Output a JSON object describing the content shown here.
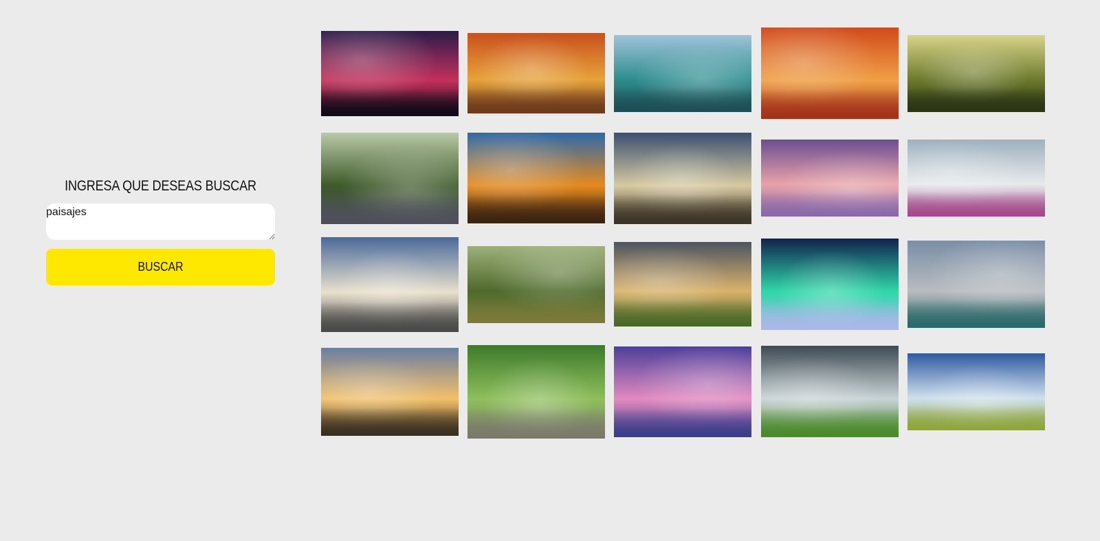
{
  "search": {
    "title": "INGRESA QUE DESEAS BUSCAR",
    "query": "paisajes",
    "button_label": "BUSCAR"
  },
  "results": [
    {
      "scene": "red-sunset-tree",
      "colors": [
        "#2a1b4a",
        "#c4305c",
        "#100a18"
      ]
    },
    {
      "scene": "autumn-forest-path",
      "colors": [
        "#c9501e",
        "#e7a23a",
        "#6d3a1a"
      ]
    },
    {
      "scene": "mountain-lake-boat",
      "colors": [
        "#9fc3d8",
        "#2e8d8f",
        "#1d4f55"
      ]
    },
    {
      "scene": "red-autumn-park",
      "colors": [
        "#d14a1c",
        "#f0a046",
        "#a3321a"
      ]
    },
    {
      "scene": "sunlit-trees-lake",
      "colors": [
        "#d9d48a",
        "#6d7a2e",
        "#2b3414"
      ]
    },
    {
      "scene": "misty-forest-road",
      "colors": [
        "#b9c9a8",
        "#3e5a2a",
        "#4f4f5c"
      ]
    },
    {
      "scene": "dramatic-sunset-clouds",
      "colors": [
        "#2d6aa8",
        "#e58a1e",
        "#3b2410"
      ]
    },
    {
      "scene": "sunrise-over-hills",
      "colors": [
        "#3b5070",
        "#d6c9a0",
        "#3c3426"
      ]
    },
    {
      "scene": "purple-lake-tree",
      "colors": [
        "#6b4e8f",
        "#e8a2a8",
        "#8a6aa8"
      ]
    },
    {
      "scene": "snowy-mountains-heather",
      "colors": [
        "#9eb0bf",
        "#e7eaec",
        "#a44a8a"
      ]
    },
    {
      "scene": "road-to-horizon",
      "colors": [
        "#4a6a9a",
        "#e9e0cc",
        "#4a4a4a"
      ]
    },
    {
      "scene": "green-forest-light",
      "colors": [
        "#9db07a",
        "#4f6a2c",
        "#7a7a3a"
      ]
    },
    {
      "scene": "giant-book-landscape",
      "colors": [
        "#4c5560",
        "#d9b26a",
        "#4a6a28"
      ]
    },
    {
      "scene": "aurora-snow",
      "colors": [
        "#0f2350",
        "#2ed8a8",
        "#a9b8e8"
      ]
    },
    {
      "scene": "alpine-lake-cabin",
      "colors": [
        "#7a8ea6",
        "#b8bcc0",
        "#2a6a6a"
      ]
    },
    {
      "scene": "river-sunset",
      "colors": [
        "#6a7fa0",
        "#f2c068",
        "#3a3020"
      ]
    },
    {
      "scene": "garden-bridge",
      "colors": [
        "#3d7a2c",
        "#8fbf5c",
        "#7a7a6a"
      ]
    },
    {
      "scene": "pink-sea-boat",
      "colors": [
        "#4b3f9a",
        "#e28ac0",
        "#3b3f8a"
      ]
    },
    {
      "scene": "storm-tree-hill",
      "colors": [
        "#3d4a52",
        "#c9d3d6",
        "#4a8a2a"
      ]
    },
    {
      "scene": "country-road-tree",
      "colors": [
        "#2f5aa0",
        "#cfe0ec",
        "#8fa63c"
      ]
    }
  ]
}
